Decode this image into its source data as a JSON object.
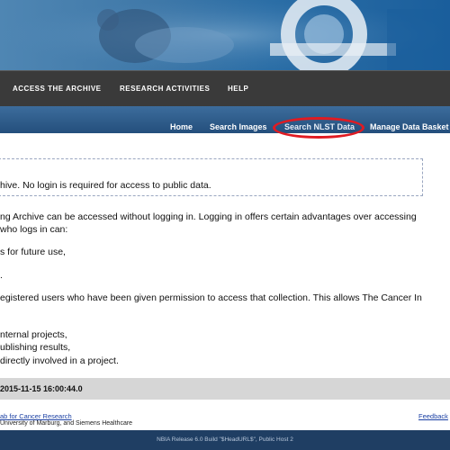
{
  "nav": {
    "access": "ACCESS THE ARCHIVE",
    "research": "RESEARCH ACTIVITIES",
    "help": "HELP"
  },
  "subnav": {
    "home": "Home",
    "search_images": "Search Images",
    "search_nlst": "Search NLST Data",
    "manage_basket": "Manage Data Basket"
  },
  "notice": "hive. No login is required for access to public data.",
  "body": {
    "line1": "ng Archive can be accessed without logging in. Logging in offers certain advantages over accessing",
    "line2": "who logs in can:",
    "line3": "s for future use,",
    "line4": ".",
    "line5": "egistered users who have been given permission to access that collection. This allows The Cancer In",
    "line6": "nternal projects,",
    "line7": "ublishing results,",
    "line8": "directly involved in a project."
  },
  "datebar": "2015-11-15 16:00:44.0",
  "footer": {
    "lab_link": "ab for Cancer Research",
    "partners": "University of Marburg, and Siemens Healthcare",
    "feedback": "Feedback"
  },
  "release": "NBIA Release 6.0 Build \"$HeadURL$\", Public Host 2"
}
